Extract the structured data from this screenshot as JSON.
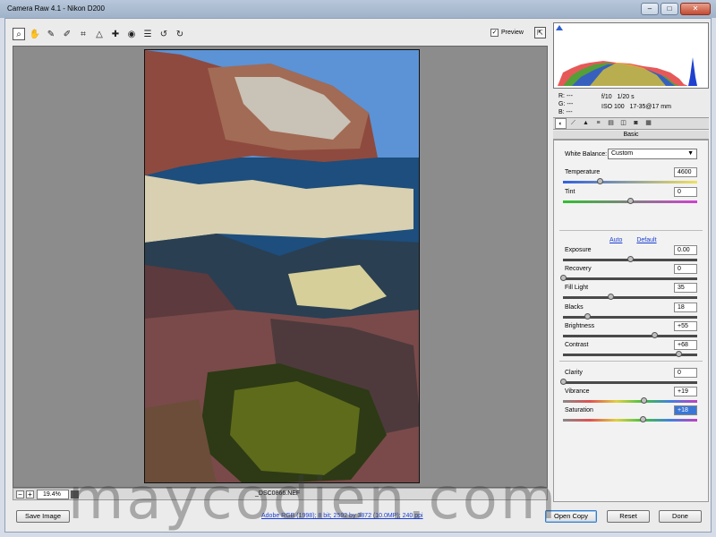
{
  "window": {
    "title": "Camera Raw 4.1  -  Nikon D200"
  },
  "toolbar": {
    "tools": [
      "zoom-icon",
      "hand-icon",
      "white-balance-eyedropper-icon",
      "color-sampler-icon",
      "crop-icon",
      "straighten-icon",
      "retouch-icon",
      "red-eye-icon",
      "presets-icon",
      "rotate-ccw-icon",
      "rotate-cw-icon"
    ],
    "preview_label": "Preview",
    "preview_checked": true
  },
  "image": {
    "filename": "_DSC0866.NEF"
  },
  "zoom": {
    "value": "19.4%"
  },
  "info": {
    "r": "R:  ---",
    "g": "G:  ---",
    "b": "B:  ---",
    "aperture": "f/10",
    "shutter": "1/20 s",
    "iso": "ISO 100",
    "lens": "17-35@17 mm"
  },
  "panel": {
    "title": "Basic",
    "white_balance_label": "White Balance:",
    "white_balance_value": "Custom",
    "auto_label": "Auto",
    "default_label": "Default",
    "sliders": [
      {
        "label": "Temperature",
        "value": "4600",
        "pos": 0.27,
        "track": "temperature"
      },
      {
        "label": "Tint",
        "value": "0",
        "pos": 0.5,
        "track": "tint"
      },
      {
        "label": "Exposure",
        "value": "0.00",
        "pos": 0.5,
        "track": "gray"
      },
      {
        "label": "Recovery",
        "value": "0",
        "pos": 0.0,
        "track": "gray"
      },
      {
        "label": "Fill Light",
        "value": "35",
        "pos": 0.35,
        "track": "gray"
      },
      {
        "label": "Blacks",
        "value": "18",
        "pos": 0.18,
        "track": "gray"
      },
      {
        "label": "Brightness",
        "value": "+55",
        "pos": 0.68,
        "track": "gray"
      },
      {
        "label": "Contrast",
        "value": "+68",
        "pos": 0.86,
        "track": "gray"
      },
      {
        "label": "Clarity",
        "value": "0",
        "pos": 0.0,
        "track": "gray"
      },
      {
        "label": "Vibrance",
        "value": "+19",
        "pos": 0.6,
        "track": "vibrance"
      },
      {
        "label": "Saturation",
        "value": "+18",
        "pos": 0.59,
        "track": "vibrance"
      }
    ]
  },
  "buttons": {
    "save_image": "Save Image",
    "workflow_link": "Adobe RGB (1998); 8 bit; 2592 by 3872 (10.0MP); 240 ppi",
    "open_copy": "Open Copy",
    "reset": "Reset",
    "done": "Done"
  }
}
